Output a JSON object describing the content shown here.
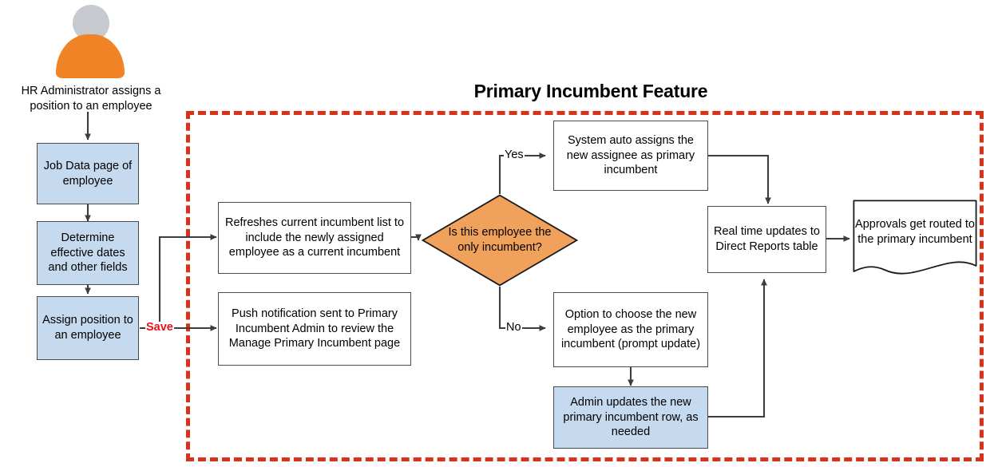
{
  "diagram": {
    "title": "Primary Incumbent Feature",
    "actor": {
      "icon": "user-avatar-icon",
      "caption": "HR Administrator assigns a position to an employee"
    },
    "colors": {
      "region_border": "#d8321a",
      "decision_fill": "#f0a15c",
      "process_fill_blue": "#c5d9ef",
      "process_fill_white": "#ffffff",
      "node_stroke": "#4a4a4a",
      "connector": "#3d3d3d",
      "save_label": "#e8121a",
      "actor_body": "#f08325",
      "actor_head": "#c6cace"
    },
    "nodes": {
      "job_data": "Job Data page of employee",
      "determine_dates": "Determine effective dates and other fields",
      "assign_position": "Assign position to an employee",
      "refresh_list": "Refreshes current incumbent list to include the newly assigned employee as a current incumbent",
      "push_notification": "Push notification sent to Primary Incumbent Admin to review the Manage Primary Incumbent page",
      "decision": "Is this employee the only incumbent?",
      "auto_assign": "System auto assigns the new assignee as primary incumbent",
      "option_choose": "Option to choose the new employee as the primary incumbent (prompt update)",
      "admin_updates": "Admin updates the new primary incumbent row, as needed",
      "realtime_updates": "Real time updates to Direct Reports table",
      "approvals": "Approvals get routed to the primary incumbent"
    },
    "edges": {
      "save": "Save",
      "yes": "Yes",
      "no": "No"
    }
  },
  "chart_data": {
    "type": "diagram",
    "title": "Primary Incumbent Feature",
    "nodes": [
      {
        "id": "actor",
        "label": "HR Administrator assigns a position to an employee",
        "shape": "actor",
        "fill": "#f08325"
      },
      {
        "id": "job_data",
        "label": "Job Data page of employee",
        "shape": "rect",
        "fill": "#c5d9ef"
      },
      {
        "id": "determine_dates",
        "label": "Determine effective dates and other fields",
        "shape": "rect",
        "fill": "#c5d9ef"
      },
      {
        "id": "assign_position",
        "label": "Assign position to an employee",
        "shape": "rect",
        "fill": "#c5d9ef"
      },
      {
        "id": "refresh_list",
        "label": "Refreshes current incumbent list to include the newly assigned employee as a current incumbent",
        "shape": "rect",
        "fill": "#ffffff"
      },
      {
        "id": "push_notification",
        "label": "Push notification sent to Primary Incumbent Admin to review the Manage Primary Incumbent page",
        "shape": "rect",
        "fill": "#ffffff"
      },
      {
        "id": "decision",
        "label": "Is this employee the only incumbent?",
        "shape": "diamond",
        "fill": "#f0a15c"
      },
      {
        "id": "auto_assign",
        "label": "System auto assigns the new assignee as primary incumbent",
        "shape": "rect",
        "fill": "#ffffff"
      },
      {
        "id": "option_choose",
        "label": "Option to choose the new employee as the primary incumbent (prompt update)",
        "shape": "rect",
        "fill": "#ffffff"
      },
      {
        "id": "admin_updates",
        "label": "Admin updates the new primary incumbent row, as needed",
        "shape": "rect",
        "fill": "#c5d9ef"
      },
      {
        "id": "realtime_updates",
        "label": "Real time updates to Direct Reports table",
        "shape": "rect",
        "fill": "#ffffff"
      },
      {
        "id": "approvals",
        "label": "Approvals get routed to the primary incumbent",
        "shape": "document",
        "fill": "#ffffff"
      }
    ],
    "edges": [
      {
        "from": "actor",
        "to": "job_data",
        "label": ""
      },
      {
        "from": "job_data",
        "to": "determine_dates",
        "label": ""
      },
      {
        "from": "determine_dates",
        "to": "assign_position",
        "label": ""
      },
      {
        "from": "assign_position",
        "to": "refresh_list",
        "label": "Save"
      },
      {
        "from": "assign_position",
        "to": "push_notification",
        "label": "Save"
      },
      {
        "from": "refresh_list",
        "to": "decision",
        "label": ""
      },
      {
        "from": "decision",
        "to": "auto_assign",
        "label": "Yes"
      },
      {
        "from": "decision",
        "to": "option_choose",
        "label": "No"
      },
      {
        "from": "auto_assign",
        "to": "realtime_updates",
        "label": ""
      },
      {
        "from": "option_choose",
        "to": "admin_updates",
        "label": ""
      },
      {
        "from": "admin_updates",
        "to": "realtime_updates",
        "label": ""
      },
      {
        "from": "realtime_updates",
        "to": "approvals",
        "label": ""
      }
    ],
    "groups": [
      {
        "label": "Primary Incumbent Feature",
        "style": "dashed",
        "color": "#d8321a"
      }
    ]
  }
}
